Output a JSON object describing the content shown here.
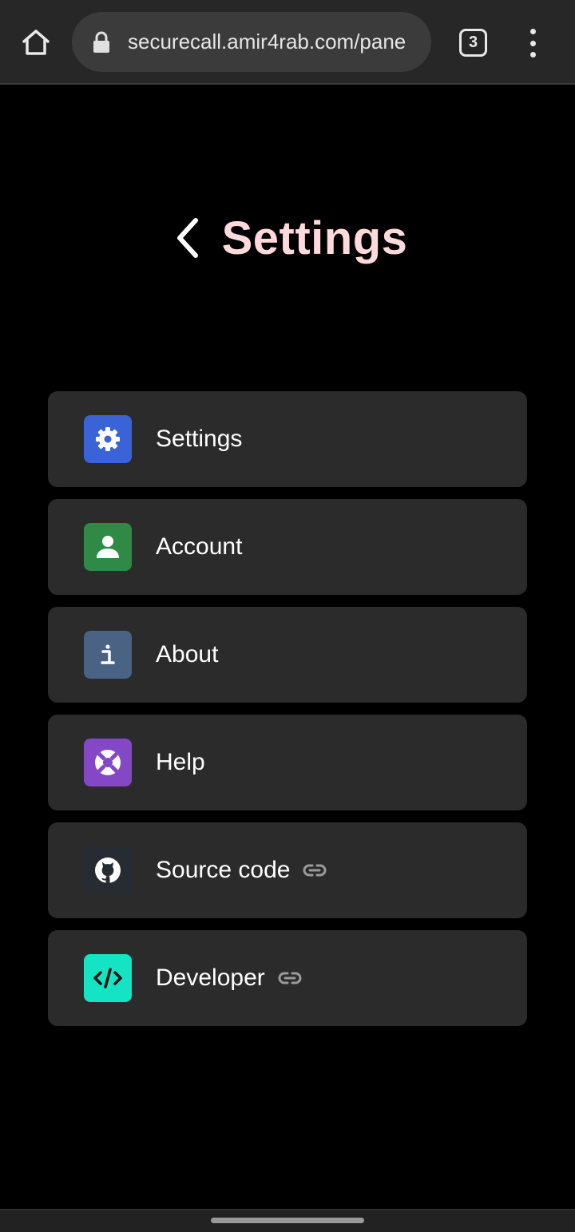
{
  "browser": {
    "url": "securecall.amir4rab.com/pane",
    "tab_count": "3",
    "icons": {
      "home": "home-icon",
      "lock": "lock-icon",
      "menu": "more-vert-icon"
    }
  },
  "header": {
    "title": "Settings",
    "title_color": "#ffd9dc",
    "back_icon": "chevron-left-icon"
  },
  "menu": {
    "items": [
      {
        "label": "Settings",
        "icon": "gear-icon",
        "color": "#3a63d8",
        "external": false
      },
      {
        "label": "Account",
        "icon": "person-icon",
        "color": "#2e8a45",
        "external": false
      },
      {
        "label": "About",
        "icon": "info-icon",
        "color": "#4a6283",
        "external": false
      },
      {
        "label": "Help",
        "icon": "lifebuoy-icon",
        "color": "#8447c6",
        "external": false
      },
      {
        "label": "Source code",
        "icon": "github-icon",
        "color": "#272c33",
        "external": true
      },
      {
        "label": "Developer",
        "icon": "code-icon",
        "color": "#14e3c4",
        "external": true
      }
    ]
  }
}
